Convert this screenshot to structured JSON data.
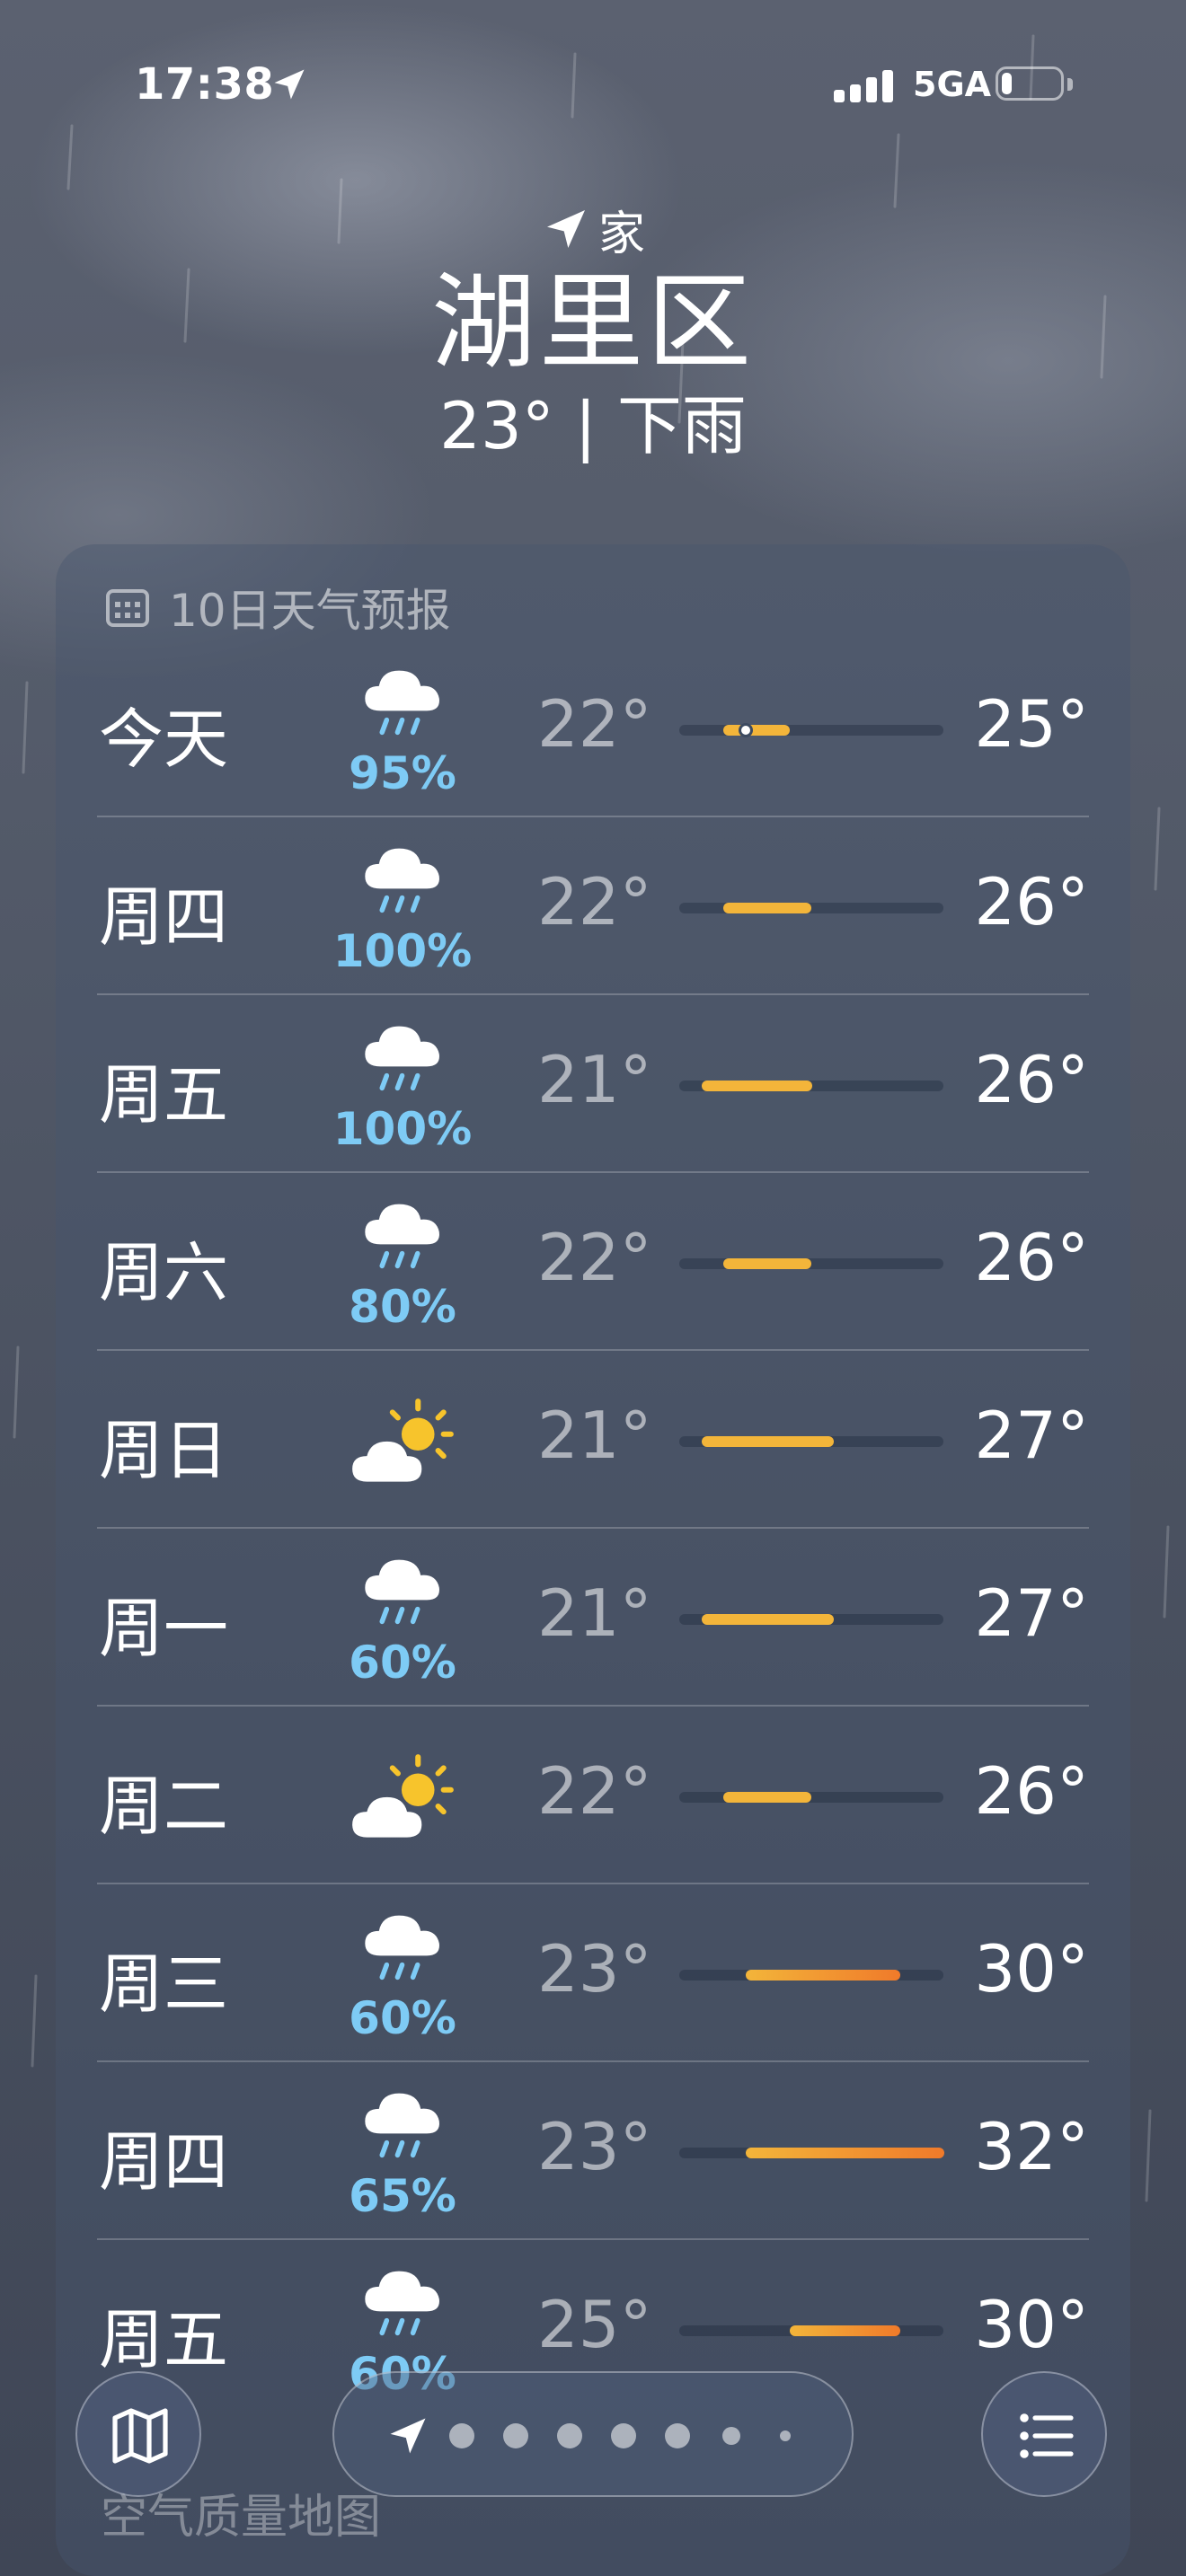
{
  "status_bar": {
    "time": "17:38",
    "network": "5GA",
    "signal_bars": 4,
    "battery_level": 0.2
  },
  "header": {
    "home_label": "家",
    "city": "湖里区",
    "summary": "23° | 下雨"
  },
  "forecast": {
    "title": "10日天气预报",
    "colors": {
      "precip": "#7ecbf5",
      "warm": "#f3b53a",
      "hot": "#f07a2a"
    },
    "days": [
      {
        "day": "今天",
        "icon": "rain-cloud-icon",
        "precip": "95%",
        "low": "22°",
        "high": "25°",
        "range": [
          22,
          25
        ],
        "current": 23
      },
      {
        "day": "周四",
        "icon": "rain-cloud-icon",
        "precip": "100%",
        "low": "22°",
        "high": "26°",
        "range": [
          22,
          26
        ]
      },
      {
        "day": "周五",
        "icon": "rain-cloud-icon",
        "precip": "100%",
        "low": "21°",
        "high": "26°",
        "range": [
          21,
          26
        ]
      },
      {
        "day": "周六",
        "icon": "rain-cloud-icon",
        "precip": "80%",
        "low": "22°",
        "high": "26°",
        "range": [
          22,
          26
        ]
      },
      {
        "day": "周日",
        "icon": "partly-sunny-icon",
        "precip": "",
        "low": "21°",
        "high": "27°",
        "range": [
          21,
          27
        ]
      },
      {
        "day": "周一",
        "icon": "rain-cloud-icon",
        "precip": "60%",
        "low": "21°",
        "high": "27°",
        "range": [
          21,
          27
        ]
      },
      {
        "day": "周二",
        "icon": "partly-sunny-icon",
        "precip": "",
        "low": "22°",
        "high": "26°",
        "range": [
          22,
          26
        ]
      },
      {
        "day": "周三",
        "icon": "rain-cloud-icon",
        "precip": "60%",
        "low": "23°",
        "high": "30°",
        "range": [
          23,
          30
        ]
      },
      {
        "day": "周四",
        "icon": "rain-cloud-icon",
        "precip": "65%",
        "low": "23°",
        "high": "32°",
        "range": [
          23,
          32
        ]
      },
      {
        "day": "周五",
        "icon": "rain-cloud-icon",
        "precip": "60%",
        "low": "25°",
        "high": "30°",
        "range": [
          25,
          30
        ]
      }
    ],
    "scale": [
      20,
      32
    ]
  },
  "below_card_text": "空气质量地图",
  "bottom_bar": {
    "map_icon": "map-icon",
    "list_icon": "list-icon",
    "pages": 7,
    "active_page": 0
  }
}
